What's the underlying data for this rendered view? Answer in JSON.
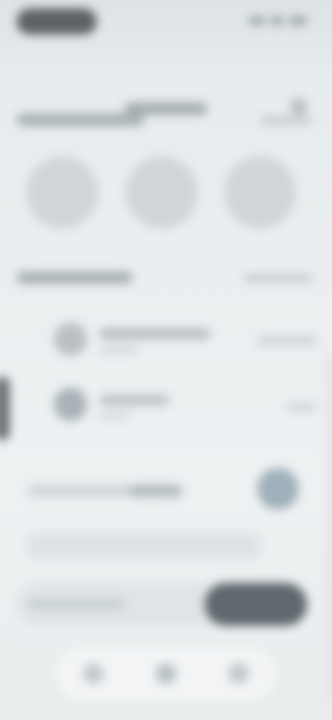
{
  "header": {
    "title": ""
  },
  "sections": {
    "top": {
      "title": "",
      "link": ""
    },
    "list": {
      "title": "",
      "link": ""
    }
  },
  "list": {
    "rows": [
      {
        "title": "",
        "subtitle": "",
        "meta": ""
      },
      {
        "title": "",
        "subtitle": "",
        "meta": ""
      }
    ]
  },
  "card": {
    "title": "",
    "highlight": ""
  },
  "bottom": {
    "label": "",
    "primary": ""
  }
}
